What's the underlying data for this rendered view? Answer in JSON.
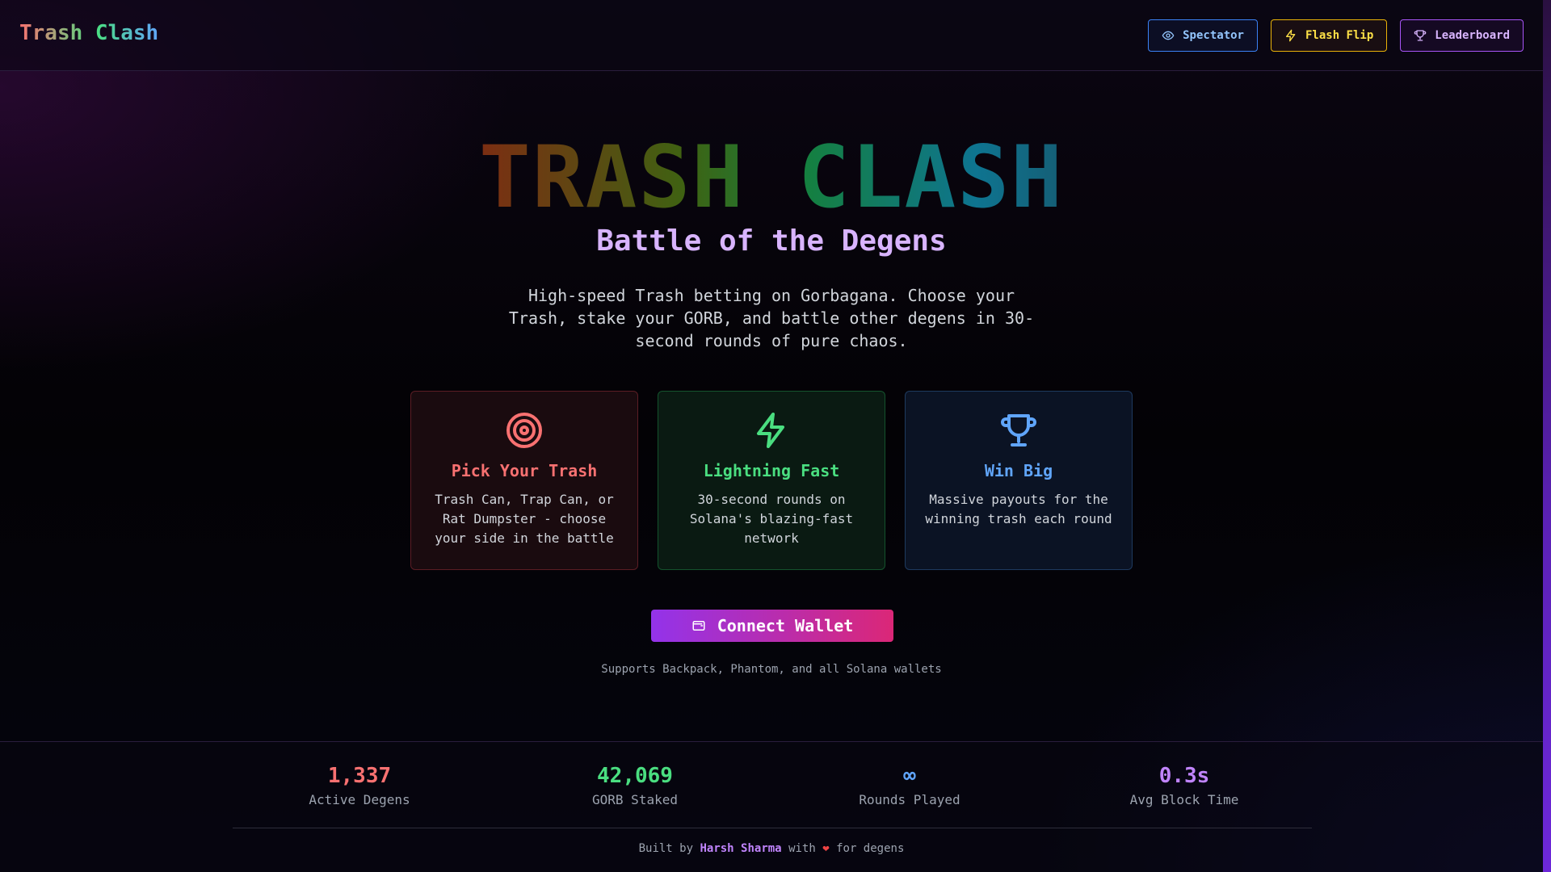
{
  "header": {
    "brand": "Trash Clash",
    "nav": {
      "spectator": "Spectator",
      "flash_flip": "Flash Flip",
      "leaderboard": "Leaderboard"
    }
  },
  "hero": {
    "title": "TRASH CLASH",
    "subtitle": "Battle of the Degens",
    "description": "High-speed Trash betting on Gorbagana. Choose your Trash, stake your GORB, and battle other degens in 30-second rounds of pure chaos."
  },
  "features": [
    {
      "icon": "target-icon",
      "title": "Pick Your Trash",
      "text": "Trash Can, Trap Can, or Rat Dumpster - choose your side in the battle",
      "color": "#f87171"
    },
    {
      "icon": "lightning-icon",
      "title": "Lightning Fast",
      "text": "30-second rounds on Solana's blazing-fast network",
      "color": "#4ade80"
    },
    {
      "icon": "trophy-icon",
      "title": "Win Big",
      "text": "Massive payouts for the winning trash each round",
      "color": "#60a5fa"
    }
  ],
  "connect": {
    "label": "Connect Wallet",
    "supports": "Supports Backpack, Phantom, and all Solana wallets"
  },
  "stats": [
    {
      "value": "1,337",
      "label": "Active Degens",
      "color": "#f87171"
    },
    {
      "value": "42,069",
      "label": "GORB Staked",
      "color": "#4ade80"
    },
    {
      "value": "∞",
      "label": "Rounds Played",
      "color": "#60a5fa"
    },
    {
      "value": "0.3s",
      "label": "Avg Block Time",
      "color": "#c084fc"
    }
  ],
  "footer": {
    "prefix": "Built by",
    "author": "Harsh Sharma",
    "middle": "with",
    "heart": "❤",
    "suffix": "for degens"
  },
  "colors": {
    "accent_purple": "#9333ea",
    "accent_pink": "#db2777"
  }
}
